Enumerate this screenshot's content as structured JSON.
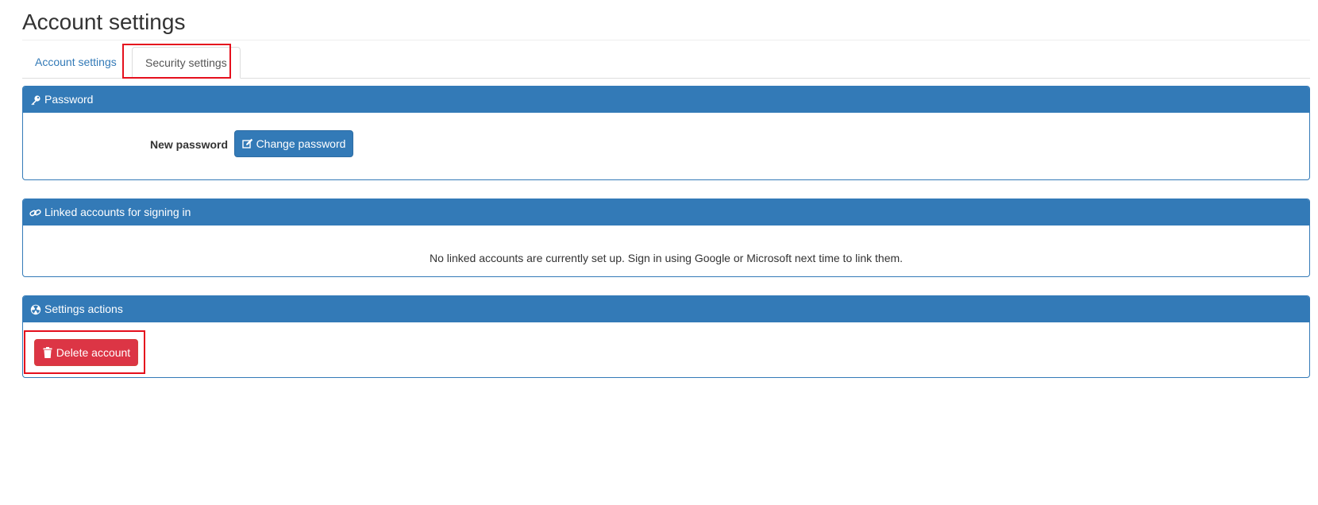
{
  "page": {
    "title": "Account settings"
  },
  "tabs": [
    {
      "label": "Account settings",
      "active": false
    },
    {
      "label": "Security settings",
      "active": true
    }
  ],
  "password_panel": {
    "heading": "Password",
    "heading_icon": "key-icon",
    "field_label": "New password",
    "button_label": "Change password",
    "button_icon": "edit-icon"
  },
  "linked_panel": {
    "heading": "Linked accounts for signing in",
    "heading_icon": "link-icon",
    "message": "No linked accounts are currently set up. Sign in using Google or Microsoft next time to link them."
  },
  "actions_panel": {
    "heading": "Settings actions",
    "heading_icon": "hazard-icon",
    "delete_label": "Delete account",
    "delete_icon": "trash-icon"
  },
  "colors": {
    "primary": "#337ab7",
    "danger": "#dc3545",
    "highlight": "#e5101d"
  }
}
